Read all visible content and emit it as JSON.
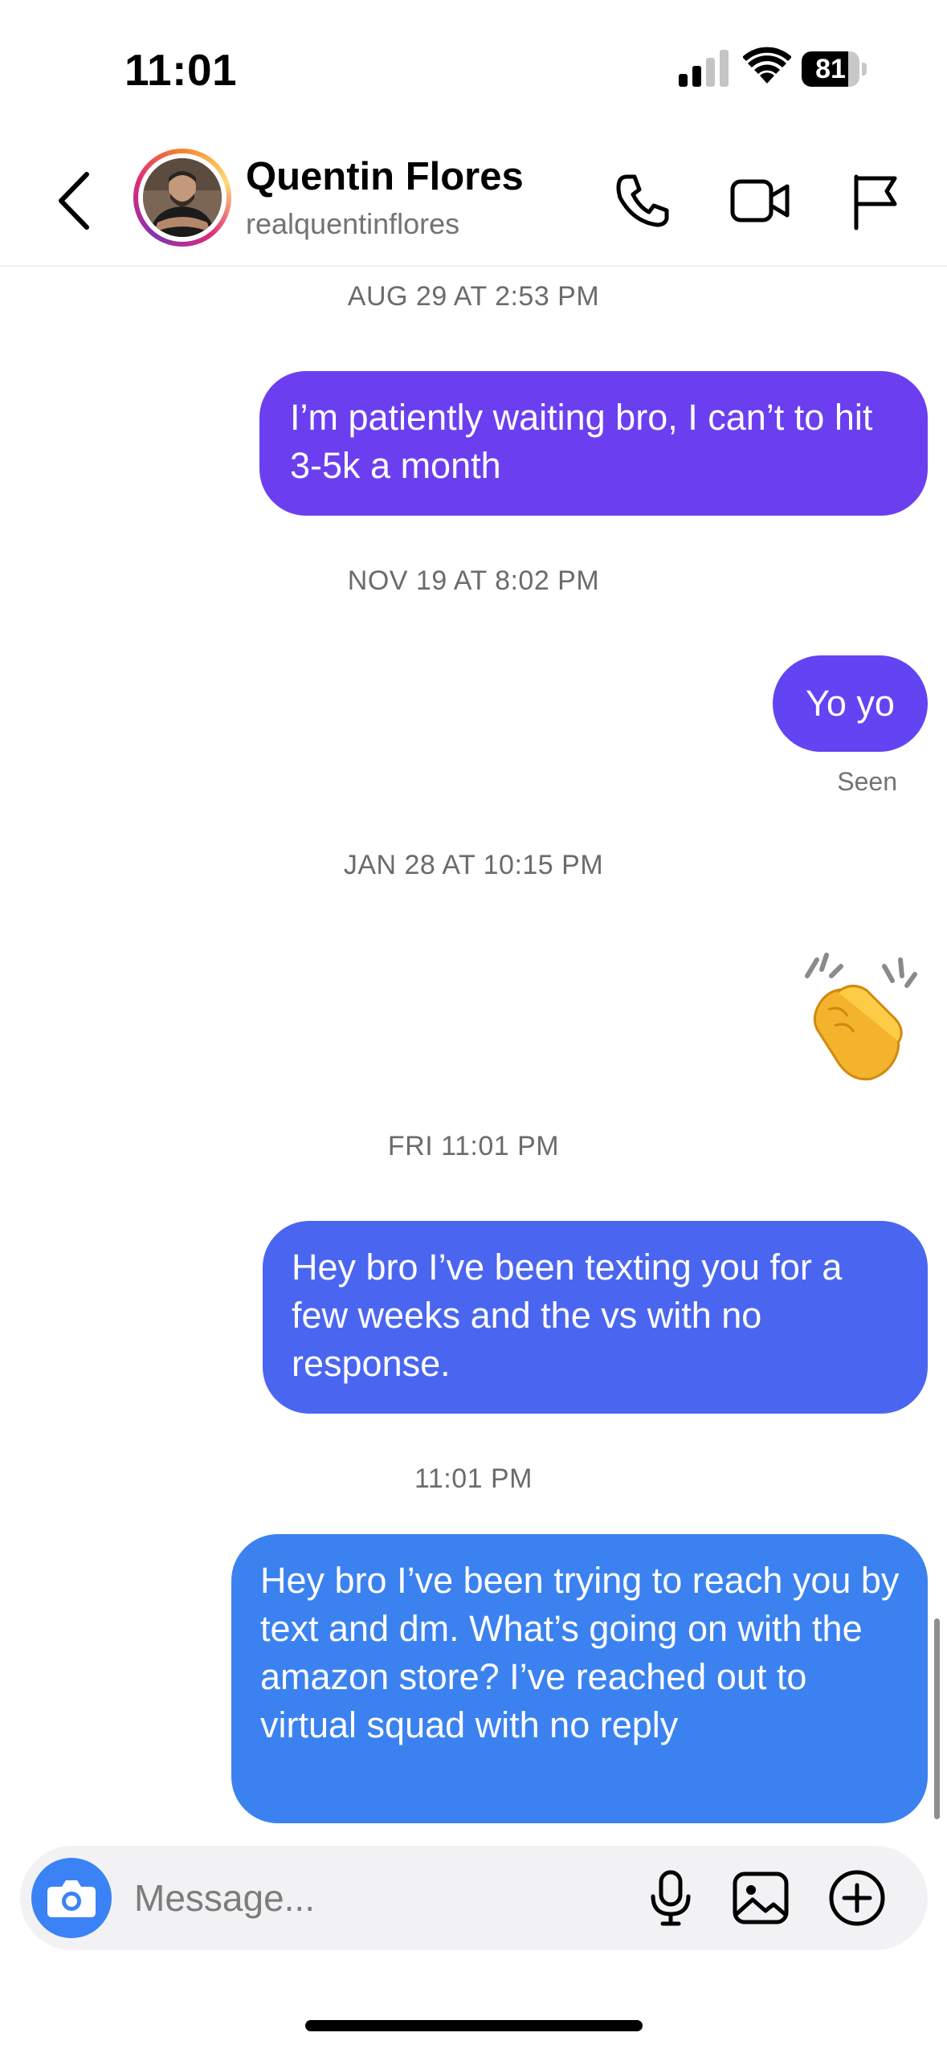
{
  "status_bar": {
    "time": "11:01",
    "battery_level": "81",
    "battery_fraction": 0.81
  },
  "header": {
    "contact_name": "Quentin Flores",
    "contact_handle": "realquentinflores",
    "icons": [
      "chevron-left-icon",
      "phone-icon",
      "video-camera-icon",
      "flag-icon"
    ]
  },
  "messages": [
    {
      "timestamp": "AUG 29 AT 2:53 PM",
      "text": "I’m patiently waiting bro,  I can’t to hit 3-5k a month",
      "color": "#6b3ff0"
    },
    {
      "timestamp": "NOV 19 AT 8:02 PM",
      "text": "Yo yo",
      "color": "#6344f2",
      "status": "Seen"
    },
    {
      "timestamp": "JAN 28 AT 10:15 PM",
      "emoji": "👏"
    },
    {
      "timestamp": "FRI 11:01 PM",
      "text": "Hey bro I’ve been texting you for a few weeks and the vs with no response.",
      "color": "#4a66f0"
    },
    {
      "timestamp": "11:01 PM",
      "text": "Hey bro I’ve been trying to reach you by text and dm. What’s going on with the amazon store? I’ve reached out to virtual squad with no reply",
      "color": "#3b82f0"
    }
  ],
  "composer": {
    "placeholder": "Message...",
    "icons": [
      "camera-icon",
      "microphone-icon",
      "image-icon",
      "plus-circle-icon"
    ],
    "camera_color": "#3b82f6"
  }
}
